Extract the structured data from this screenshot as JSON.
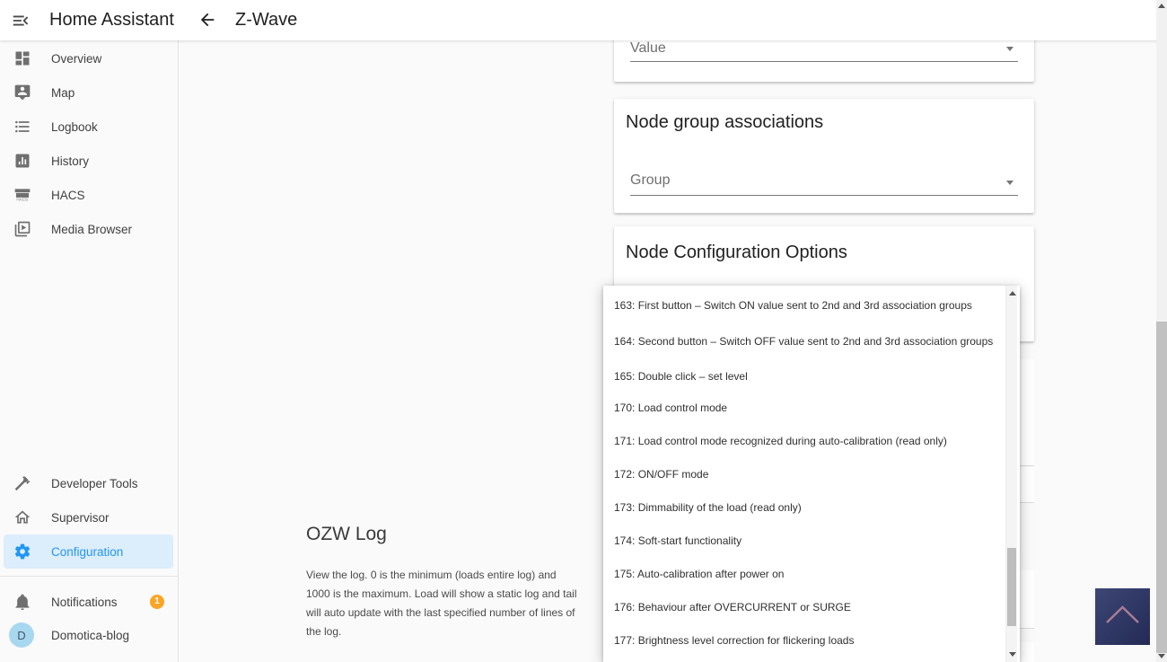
{
  "app": {
    "title": "Home Assistant"
  },
  "header": {
    "page_title": "Z-Wave"
  },
  "sidebar": {
    "items": [
      {
        "label": "Overview",
        "icon": "view-dashboard"
      },
      {
        "label": "Map",
        "icon": "tooltip-account"
      },
      {
        "label": "Logbook",
        "icon": "format-list-bulleted"
      },
      {
        "label": "History",
        "icon": "poll-box"
      },
      {
        "label": "HACS",
        "icon": "hacs-store"
      },
      {
        "label": "Media Browser",
        "icon": "play-box-multiple"
      },
      {
        "label": "Developer Tools",
        "icon": "hammer"
      },
      {
        "label": "Supervisor",
        "icon": "home-assistant"
      },
      {
        "label": "Configuration",
        "icon": "cog",
        "selected": true
      },
      {
        "label": "Notifications",
        "icon": "bell",
        "badge": "1"
      },
      {
        "label": "Domotica-blog",
        "icon": "avatar",
        "avatar_letter": "D"
      }
    ]
  },
  "cards": {
    "value_select": {
      "label": "Value"
    },
    "node_group": {
      "title": "Node group associations",
      "select_label": "Group"
    },
    "node_config": {
      "title": "Node Configuration Options"
    }
  },
  "dropdown": {
    "options": [
      "163: First button – Switch ON value sent to 2nd and 3rd association groups",
      "164: Second button – Switch OFF value sent to 2nd and 3rd association groups",
      "165: Double click – set level",
      "170: Load control mode",
      "171: Load control mode recognized during auto-calibration (read only)",
      "172: ON/OFF mode",
      "173: Dimmability of the load (read only)",
      "174: Soft-start functionality",
      "175: Auto-calibration after power on",
      "176: Behaviour after OVERCURRENT or SURGE",
      "177: Brightness level correction for flickering loads"
    ]
  },
  "ozw_log": {
    "title": "OZW Log",
    "description": "View the log. 0 is the minimum (loads entire log) and 1000 is the maximum. Load will show a static log and tail will auto update with the last specified number of lines of the log."
  },
  "colors": {
    "accent": "#2196f3",
    "badge": "#faa525",
    "avatar_bg": "#a8d7f0",
    "scroll_top_bg": "#2b3462",
    "scroll_top_chevron": "#a87c92"
  }
}
